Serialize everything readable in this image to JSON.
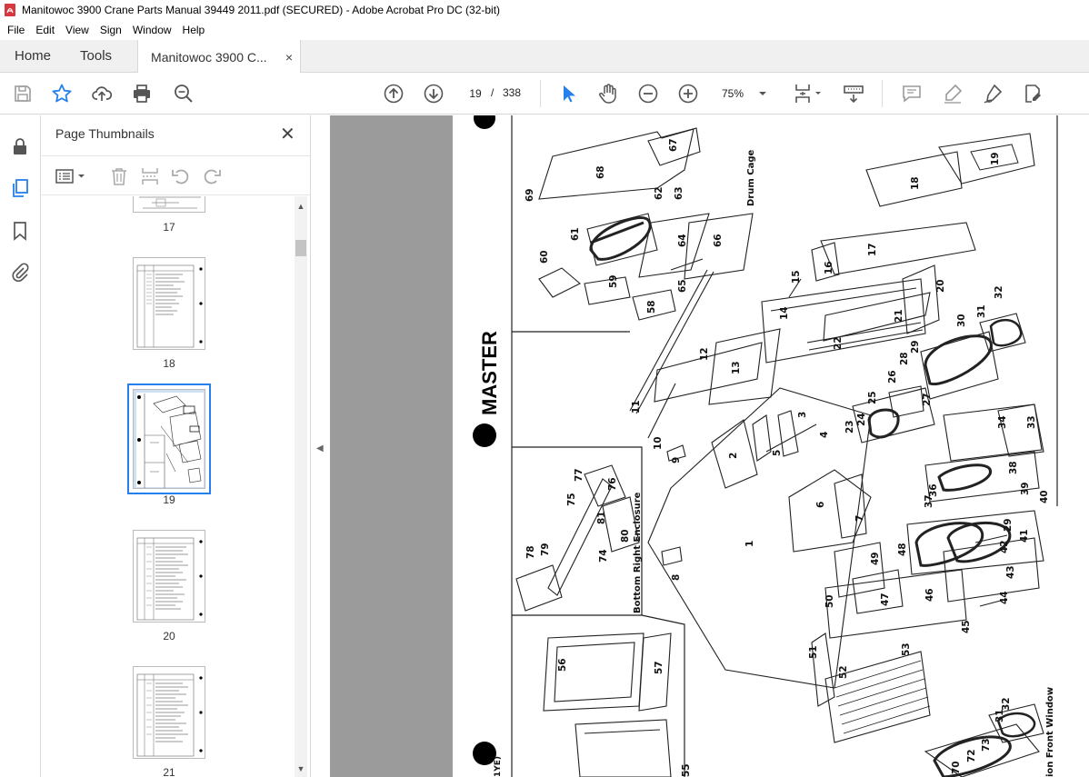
{
  "window": {
    "title": "Manitowoc 3900 Crane Parts Manual 39449 2011.pdf (SECURED) - Adobe Acrobat Pro DC (32-bit)"
  },
  "menu": [
    "File",
    "Edit",
    "View",
    "Sign",
    "Window",
    "Help"
  ],
  "tabs": {
    "home": "Home",
    "tools": "Tools",
    "document": "Manitowoc 3900 C...",
    "close": "×"
  },
  "toolbar": {
    "page_current": "19",
    "page_sep": "/",
    "page_total": "338",
    "zoom": "75%"
  },
  "panel": {
    "title": "Page Thumbnails",
    "close": "✕",
    "thumbnails": [
      {
        "label": "17"
      },
      {
        "label": "18"
      },
      {
        "label": "19"
      },
      {
        "label": "20"
      },
      {
        "label": "21"
      }
    ]
  },
  "drawing": {
    "master_label": "MASTER",
    "section_labels": [
      "Drum Cage",
      "Bottom Right Enclosure",
      "ion Front Window"
    ],
    "part_numbers": [
      "1",
      "2",
      "3",
      "4",
      "5",
      "6",
      "7",
      "8",
      "9",
      "10",
      "11",
      "12",
      "13",
      "14",
      "15",
      "16",
      "17",
      "18",
      "19",
      "20",
      "21",
      "22",
      "23",
      "24",
      "25",
      "26",
      "27",
      "28",
      "29",
      "30",
      "31",
      "32",
      "33",
      "34",
      "36",
      "37",
      "38",
      "39",
      "40",
      "41",
      "42",
      "43",
      "44",
      "45",
      "46",
      "47",
      "48",
      "49",
      "50",
      "51",
      "52",
      "53",
      "55",
      "56",
      "57",
      "58",
      "59",
      "60",
      "61",
      "62",
      "63",
      "64",
      "65",
      "66",
      "67",
      "68",
      "69",
      "70",
      "72",
      "73",
      "74",
      "75",
      "76",
      "77",
      "78",
      "79",
      "80",
      "81"
    ],
    "footer_fragment": "1YE)"
  },
  "colors": {
    "accent": "#2680eb",
    "canvas": "#9b9b9b",
    "icon": "#6e6e6e",
    "pdf_red": "#d7373f"
  }
}
